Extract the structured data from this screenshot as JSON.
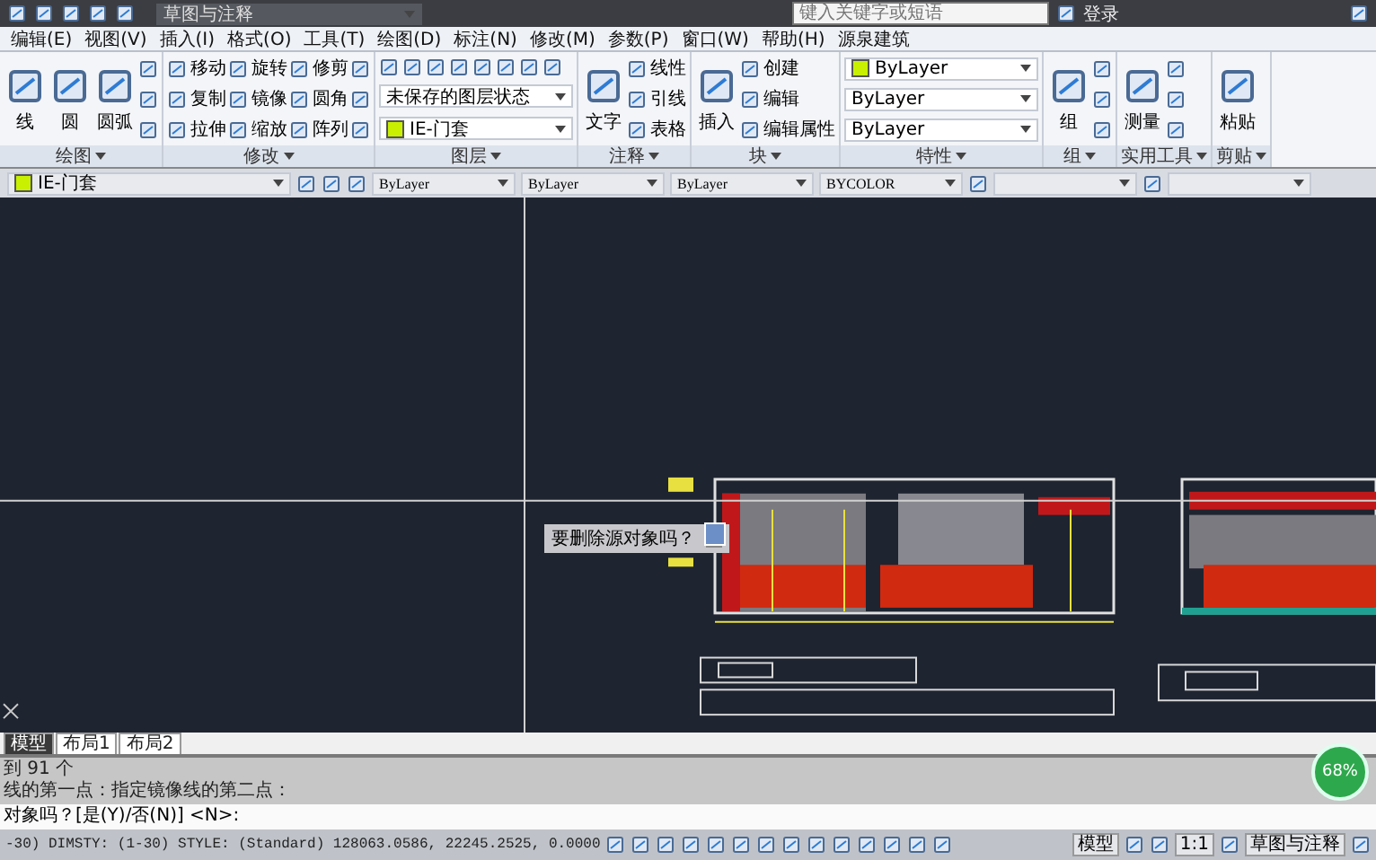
{
  "title_bar": {
    "workspace": "草图与注释",
    "search": {
      "placeholder": "键入关键字或短语"
    },
    "user": "登录"
  },
  "menu": [
    "编辑(E)",
    "视图(V)",
    "插入(I)",
    "格式(O)",
    "工具(T)",
    "绘图(D)",
    "标注(N)",
    "修改(M)",
    "参数(P)",
    "窗口(W)",
    "帮助(H)",
    "源泉建筑"
  ],
  "ribbon": [
    {
      "title": "绘图",
      "columns": [
        [
          {
            "kind": "large",
            "label": "线"
          }
        ],
        [
          {
            "kind": "large",
            "label": "圆"
          }
        ],
        [
          {
            "kind": "large",
            "label": "圆弧"
          }
        ],
        [
          {
            "kind": "icon"
          },
          {
            "kind": "icon"
          },
          {
            "kind": "icon"
          }
        ]
      ]
    },
    {
      "title": "修改",
      "columns": [
        [
          {
            "kind": "small",
            "label": "移动"
          },
          {
            "kind": "small",
            "label": "复制"
          },
          {
            "kind": "small",
            "label": "拉伸"
          }
        ],
        [
          {
            "kind": "small",
            "label": "旋转"
          },
          {
            "kind": "small",
            "label": "镜像"
          },
          {
            "kind": "small",
            "label": "缩放"
          }
        ],
        [
          {
            "kind": "small",
            "label": "修剪"
          },
          {
            "kind": "small",
            "label": "圆角"
          },
          {
            "kind": "small",
            "label": "阵列"
          }
        ],
        [
          {
            "kind": "icon"
          },
          {
            "kind": "icon"
          },
          {
            "kind": "icon"
          }
        ]
      ]
    },
    {
      "title": "图层",
      "columns": [
        [
          {
            "kind": "iconrow"
          },
          {
            "kind": "dropdown",
            "label": "未保存的图层状态"
          },
          {
            "kind": "dropdown",
            "label": "IE-门套",
            "color": "#c8f000"
          }
        ]
      ]
    },
    {
      "title": "注释",
      "columns": [
        [
          {
            "kind": "large",
            "label": "文字"
          }
        ],
        [
          {
            "kind": "small",
            "label": "线性"
          },
          {
            "kind": "small",
            "label": "引线"
          },
          {
            "kind": "small",
            "label": "表格"
          }
        ]
      ]
    },
    {
      "title": "块",
      "columns": [
        [
          {
            "kind": "large",
            "label": "插入"
          }
        ],
        [
          {
            "kind": "small",
            "label": "创建"
          },
          {
            "kind": "small",
            "label": "编辑"
          },
          {
            "kind": "small",
            "label": "编辑属性"
          }
        ]
      ]
    },
    {
      "title": "特性",
      "columns": [
        [
          {
            "kind": "dropdown",
            "label": "ByLayer",
            "color": "#c8f000"
          },
          {
            "kind": "dropdown",
            "label": "ByLayer"
          },
          {
            "kind": "dropdown",
            "label": "ByLayer"
          }
        ]
      ]
    },
    {
      "title": "组",
      "columns": [
        [
          {
            "kind": "large",
            "label": "组"
          }
        ],
        [
          {
            "kind": "icon"
          },
          {
            "kind": "icon"
          },
          {
            "kind": "icon"
          }
        ]
      ]
    },
    {
      "title": "实用工具",
      "columns": [
        [
          {
            "kind": "large",
            "label": "测量"
          }
        ],
        [
          {
            "kind": "icon"
          },
          {
            "kind": "icon"
          },
          {
            "kind": "icon"
          }
        ]
      ]
    },
    {
      "title": "剪贴",
      "columns": [
        [
          {
            "kind": "large",
            "label": "粘贴"
          }
        ]
      ]
    }
  ],
  "properties_bar": [
    {
      "kind": "dropdown",
      "label": "IE-门套",
      "color": "#c8f000"
    },
    {
      "kind": "icon"
    },
    {
      "kind": "icon"
    },
    {
      "kind": "icon"
    },
    {
      "kind": "dropdown",
      "label": "ByLayer"
    },
    {
      "kind": "dropdown",
      "label": "ByLayer"
    },
    {
      "kind": "dropdown",
      "label": "ByLayer"
    },
    {
      "kind": "dropdown",
      "label": "BYCOLOR"
    },
    {
      "kind": "icon"
    },
    {
      "kind": "dropdown"
    },
    {
      "kind": "icon"
    },
    {
      "kind": "dropdown"
    }
  ],
  "prompt": {
    "text": "要删除源对象吗？"
  },
  "layout_tabs": [
    {
      "label": "模型",
      "selected": true
    },
    {
      "label": "布局1",
      "selected": false
    },
    {
      "label": "布局2",
      "selected": false
    }
  ],
  "command_history": [
    "到 91 个",
    "线的第一点：指定镜像线的第二点："
  ],
  "command_line": "对象吗？[是(Y)/否(N)] <N>:",
  "status_bar": {
    "coordinates": "-30) DIMSTY: (1-30) STYLE: (Standard)  128063.0586, 22245.2525, 0.0000",
    "model": "模型",
    "scale": "1:1",
    "workspace": "草图与注释"
  },
  "speed_badge": "68%"
}
